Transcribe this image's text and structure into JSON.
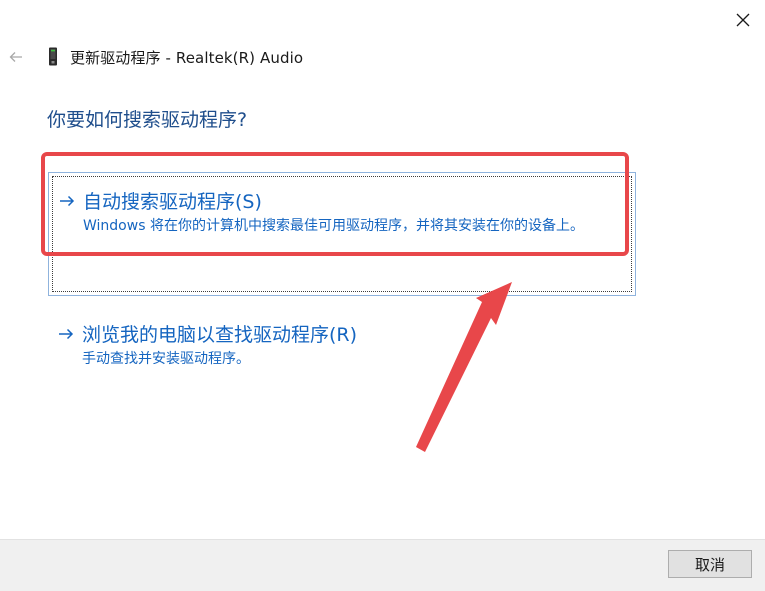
{
  "window": {
    "title": "更新驱动程序 - Realtek(R) Audio",
    "back_icon": "back-arrow-icon",
    "close_icon": "close-icon",
    "device_icon": "audio-device-icon"
  },
  "main": {
    "heading": "你要如何搜索驱动程序?",
    "options": [
      {
        "title": "自动搜索驱动程序(S)",
        "description": "Windows 将在你的计算机中搜索最佳可用驱动程序，并将其安装在你的设备上。",
        "icon": "right-arrow-icon"
      },
      {
        "title": "浏览我的电脑以查找驱动程序(R)",
        "description": "手动查找并安装驱动程序。",
        "icon": "right-arrow-icon"
      }
    ]
  },
  "footer": {
    "cancel_label": "取消"
  },
  "colors": {
    "heading": "#1f4e8c",
    "link": "#1565c0",
    "annotation": "#e8474a",
    "footer_bg": "#f0f0f0"
  }
}
